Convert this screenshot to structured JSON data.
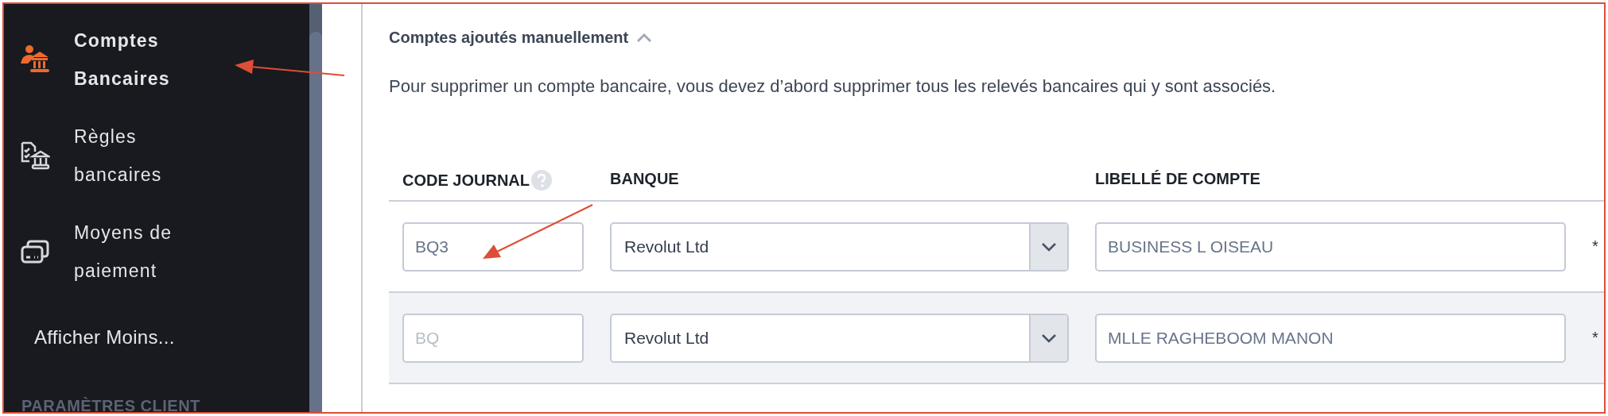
{
  "sidebar": {
    "items": [
      {
        "label": "Comptes Bancaires",
        "kind": "bank-people",
        "selected": true
      },
      {
        "label": "Règles bancaires",
        "kind": "rules",
        "selected": false
      },
      {
        "label": "Moyens de paiement",
        "kind": "cards",
        "selected": false
      },
      {
        "label": "Afficher Moins...",
        "selected": false
      }
    ],
    "section_title": "PARAMÈTRES CLIENT"
  },
  "section": {
    "title": "Comptes ajoutés manuellement",
    "expanded": true,
    "description": "Pour supprimer un compte bancaire, vous devez d’abord supprimer tous les relevés bancaires qui y sont associés."
  },
  "table": {
    "columns": [
      {
        "label": "CODE JOURNAL",
        "help": true
      },
      {
        "label": "BANQUE",
        "help": false
      },
      {
        "label": "LIBELLÉ DE COMPTE",
        "help": false
      }
    ],
    "rows": [
      {
        "code": {
          "value": "BQ3"
        },
        "bank": "Revolut Ltd",
        "label": "BUSINESS L OISEAU",
        "column_4": "*",
        "highlighted": false
      },
      {
        "code": {
          "placeholder": "BQ"
        },
        "bank": "Revolut Ltd",
        "label": "MLLE RAGHEBOOM MANON",
        "column_4": "*",
        "highlighted": true
      }
    ]
  }
}
